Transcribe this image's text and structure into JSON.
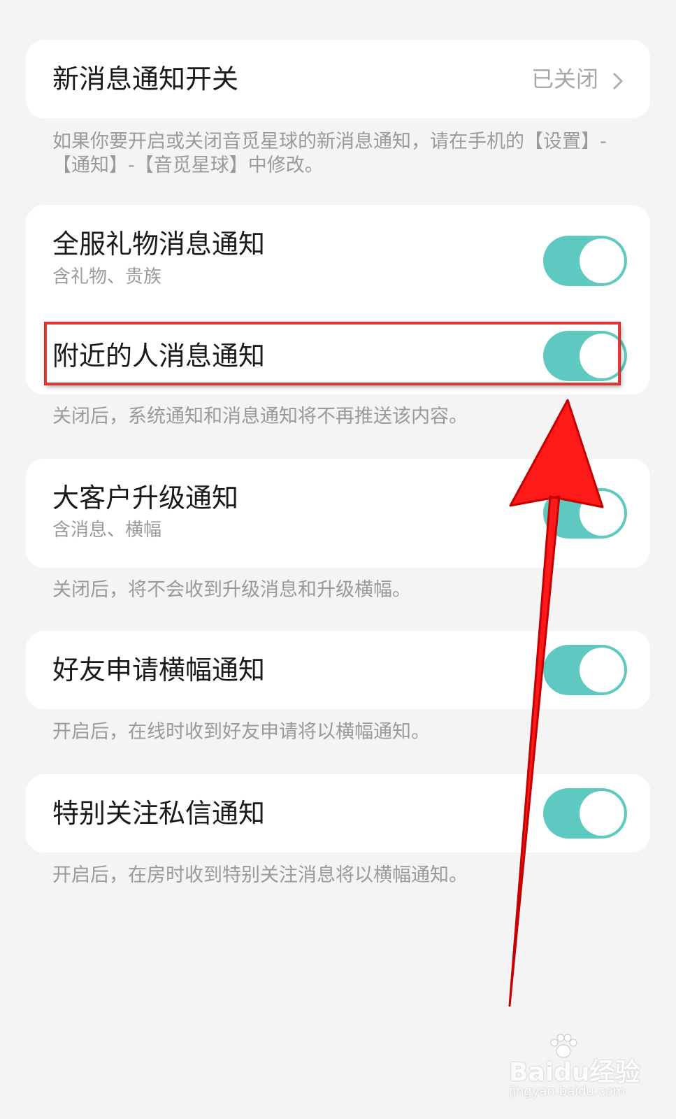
{
  "new_message": {
    "title": "新消息通知开关",
    "value": "已关闭",
    "description": "如果你要开启或关闭音觅星球的新消息通知，请在手机的【设置】-【通知】-【音觅星球】中修改。"
  },
  "group1": {
    "items": [
      {
        "title": "全服礼物消息通知",
        "subtitle": "含礼物、贵族",
        "enabled": true
      },
      {
        "title": "附近的人消息通知",
        "enabled": true
      }
    ],
    "description": "关闭后，系统通知和消息通知将不再推送该内容。"
  },
  "group2": {
    "title": "大客户升级通知",
    "subtitle": "含消息、横幅",
    "enabled": true,
    "description": "关闭后，将不会收到升级消息和升级横幅。"
  },
  "group3": {
    "title": "好友申请横幅通知",
    "enabled": true,
    "description": "开启后，在线时收到好友申请将以横幅通知。"
  },
  "group4": {
    "title": "特别关注私信通知",
    "enabled": true,
    "description": "开启后，在房时收到特别关注消息将以横幅通知。"
  },
  "colors": {
    "toggle_on": "#5ec9c0",
    "background": "#f4f4f4",
    "annotation": "#e53935"
  },
  "watermark": {
    "brand": "Baidu经验",
    "url": "jingyan.baidu.com"
  }
}
